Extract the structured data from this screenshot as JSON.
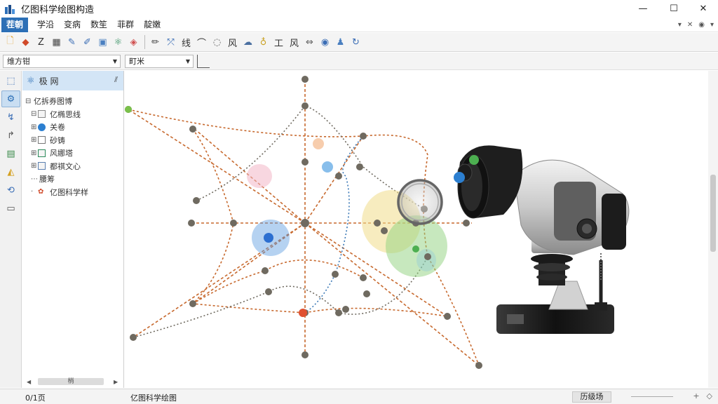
{
  "app": {
    "title": "亿图科学绘图构造",
    "window_controls": [
      "—",
      "☐",
      "✕"
    ]
  },
  "menu": {
    "items": [
      "茬朝",
      "学沿",
      "变病",
      "数笙",
      "菲群",
      "靛嫩"
    ],
    "mdi_controls": [
      "▾",
      "✕",
      "◉",
      "▾"
    ]
  },
  "toolbar": {
    "groups": [
      [
        {
          "icon": "new-file-icon",
          "glyph": "🗋",
          "color": "#e0a030"
        },
        {
          "icon": "shape-icon",
          "glyph": "◆",
          "color": "#d04a2a"
        },
        {
          "icon": "text-style-icon",
          "glyph": "Z",
          "color": "#333333"
        },
        {
          "icon": "grid-icon",
          "glyph": "▦",
          "color": "#444444"
        },
        {
          "icon": "pen-icon",
          "glyph": "✎",
          "color": "#3a6db5"
        },
        {
          "icon": "edit-icon",
          "glyph": "✐",
          "color": "#3a6db5"
        },
        {
          "icon": "image-icon",
          "glyph": "▣",
          "color": "#4a7fc0"
        },
        {
          "icon": "dna-icon",
          "glyph": "⚛",
          "color": "#2a8a5a"
        },
        {
          "icon": "box-icon",
          "glyph": "◈",
          "color": "#d05050"
        }
      ],
      [
        {
          "icon": "brush-icon",
          "glyph": "✏",
          "color": "#444444"
        },
        {
          "icon": "connect-icon",
          "glyph": "⤱",
          "color": "#3a6db5"
        },
        {
          "icon": "line-icon",
          "glyph": "线",
          "color": "#333333"
        },
        {
          "icon": "curve-icon",
          "glyph": "⌒",
          "color": "#333333"
        },
        {
          "icon": "shape-outline-icon",
          "glyph": "◌",
          "color": "#555555"
        },
        {
          "icon": "wind-icon",
          "glyph": "风",
          "color": "#333333"
        },
        {
          "icon": "cloud-icon",
          "glyph": "☁",
          "color": "#4a6fa0"
        },
        {
          "icon": "bulb-icon",
          "glyph": "♁",
          "color": "#c9a020"
        },
        {
          "icon": "table-icon",
          "glyph": "工",
          "color": "#333333"
        },
        {
          "icon": "align-icon",
          "glyph": "风",
          "color": "#333333"
        },
        {
          "icon": "flip-icon",
          "glyph": "⇔",
          "color": "#555555"
        },
        {
          "icon": "layers-icon",
          "glyph": "◉",
          "color": "#3a6db5"
        },
        {
          "icon": "figure-icon",
          "glyph": "♟",
          "color": "#4a7fc0"
        },
        {
          "icon": "rotate-icon",
          "glyph": "↻",
          "color": "#3a6db5"
        }
      ]
    ]
  },
  "combos": {
    "font_family": "维方钳",
    "font_size": "町米"
  },
  "left_strip": [
    {
      "icon": "select-icon",
      "glyph": "⬚",
      "color": "#3a6db5",
      "active": false
    },
    {
      "icon": "molecule-icon",
      "glyph": "⚙",
      "color": "#2c6fb6",
      "active": true
    },
    {
      "icon": "connector-icon",
      "glyph": "↯",
      "color": "#3a6db5",
      "active": false
    },
    {
      "icon": "route-icon",
      "glyph": "↱",
      "color": "#555555",
      "active": false
    },
    {
      "icon": "layout-icon",
      "glyph": "▤",
      "color": "#3a8a4a",
      "active": false
    },
    {
      "icon": "fill-icon",
      "glyph": "◭",
      "color": "#d4a020",
      "active": false
    },
    {
      "icon": "refresh-icon",
      "glyph": "⟲",
      "color": "#3a6db5",
      "active": false
    },
    {
      "icon": "frame-icon",
      "glyph": "▭",
      "color": "#555555",
      "active": false
    }
  ],
  "tree_panel": {
    "header_label": "极 网",
    "pin": "⫽",
    "items": [
      {
        "label": "亿拆券图博",
        "expander": "⊟",
        "indent": 0,
        "icon": "none",
        "color": ""
      },
      {
        "label": "亿椭思线",
        "expander": "⊟",
        "indent": 8,
        "icon": "square",
        "color": "#888888"
      },
      {
        "label": "关卷",
        "expander": "⊞",
        "indent": 8,
        "icon": "circle",
        "color": "#2c7fd0"
      },
      {
        "label": "砂铸",
        "expander": "⊞",
        "indent": 8,
        "icon": "page",
        "color": "#777777"
      },
      {
        "label": "风娜塔",
        "expander": "⊞",
        "indent": 8,
        "icon": "square",
        "color": "#2a8a5a"
      },
      {
        "label": "都祺文心",
        "expander": "⊞",
        "indent": 8,
        "icon": "square",
        "color": "#5a7fb0"
      },
      {
        "label": "腰筹",
        "expander": "⋯",
        "indent": 8,
        "icon": "none",
        "color": ""
      },
      {
        "label": "亿图科学样",
        "expander": "·",
        "indent": 8,
        "icon": "gear",
        "color": "#d04a2a"
      }
    ],
    "scroll_label": "梢"
  },
  "statusbar": {
    "left": "0/1页",
    "middle": "亿图科学绘图",
    "badge": "历级场",
    "icons": [
      "+",
      "◇"
    ]
  },
  "canvas": {
    "dot_color": "#6f6a60",
    "line_color": "#c7692e",
    "blue_line_color": "#3a78b6"
  }
}
